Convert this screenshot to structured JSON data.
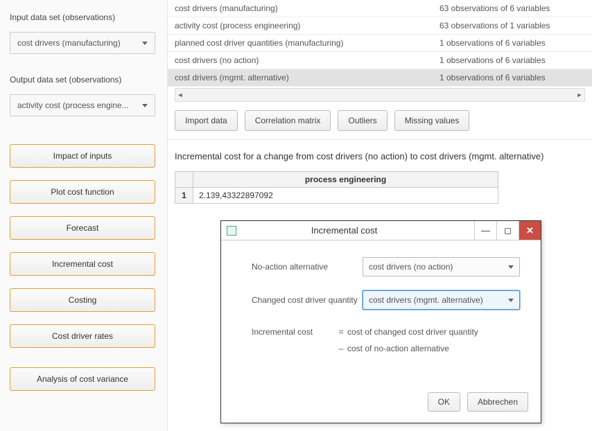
{
  "sidebar": {
    "input_label": "Input data set (observations)",
    "input_value": "cost drivers (manufacturing)",
    "output_label": "Output data set (observations)",
    "output_value": "activity cost (process engine...",
    "buttons": {
      "impact": "Impact of inputs",
      "plot": "Plot cost function",
      "forecast": "Forecast",
      "incremental": "Incremental cost",
      "costing": "Costing",
      "rates": "Cost driver rates",
      "variance": "Analysis of cost variance"
    }
  },
  "datasets": {
    "rows": [
      {
        "name": "cost drivers (manufacturing)",
        "desc": "63 observations of 6 variables"
      },
      {
        "name": "activity cost (process engineering)",
        "desc": "63 observations of 1 variables"
      },
      {
        "name": "planned cost driver quantities (manufacturing)",
        "desc": "1 observations of 6 variables"
      },
      {
        "name": "cost drivers (no action)",
        "desc": "1 observations of 6 variables"
      },
      {
        "name": "cost drivers (mgmt. alternative)",
        "desc": "1 observations of 6 variables"
      }
    ]
  },
  "toolbar": {
    "import": "Import data",
    "correlation": "Correlation matrix",
    "outliers": "Outliers",
    "missing": "Missing values"
  },
  "content": {
    "title": "Incremental cost for a change from cost drivers (no action) to cost drivers (mgmt. alternative)",
    "result_header": "process engineering",
    "result_rownum": "1",
    "result_value": "2.139,43322897092"
  },
  "dialog": {
    "title": "Incremental cost",
    "noaction_label": "No-action alternative",
    "noaction_value": "cost drivers (no action)",
    "changed_label": "Changed cost driver quantity",
    "changed_value": "cost drivers (mgmt. alternative)",
    "formula_left": "Incremental cost",
    "formula_eq": "=",
    "formula_r1": "cost of changed cost driver quantity",
    "formula_minus": "–",
    "formula_r2": "cost of no-action alternative",
    "ok": "OK",
    "cancel": "Abbrechen"
  }
}
